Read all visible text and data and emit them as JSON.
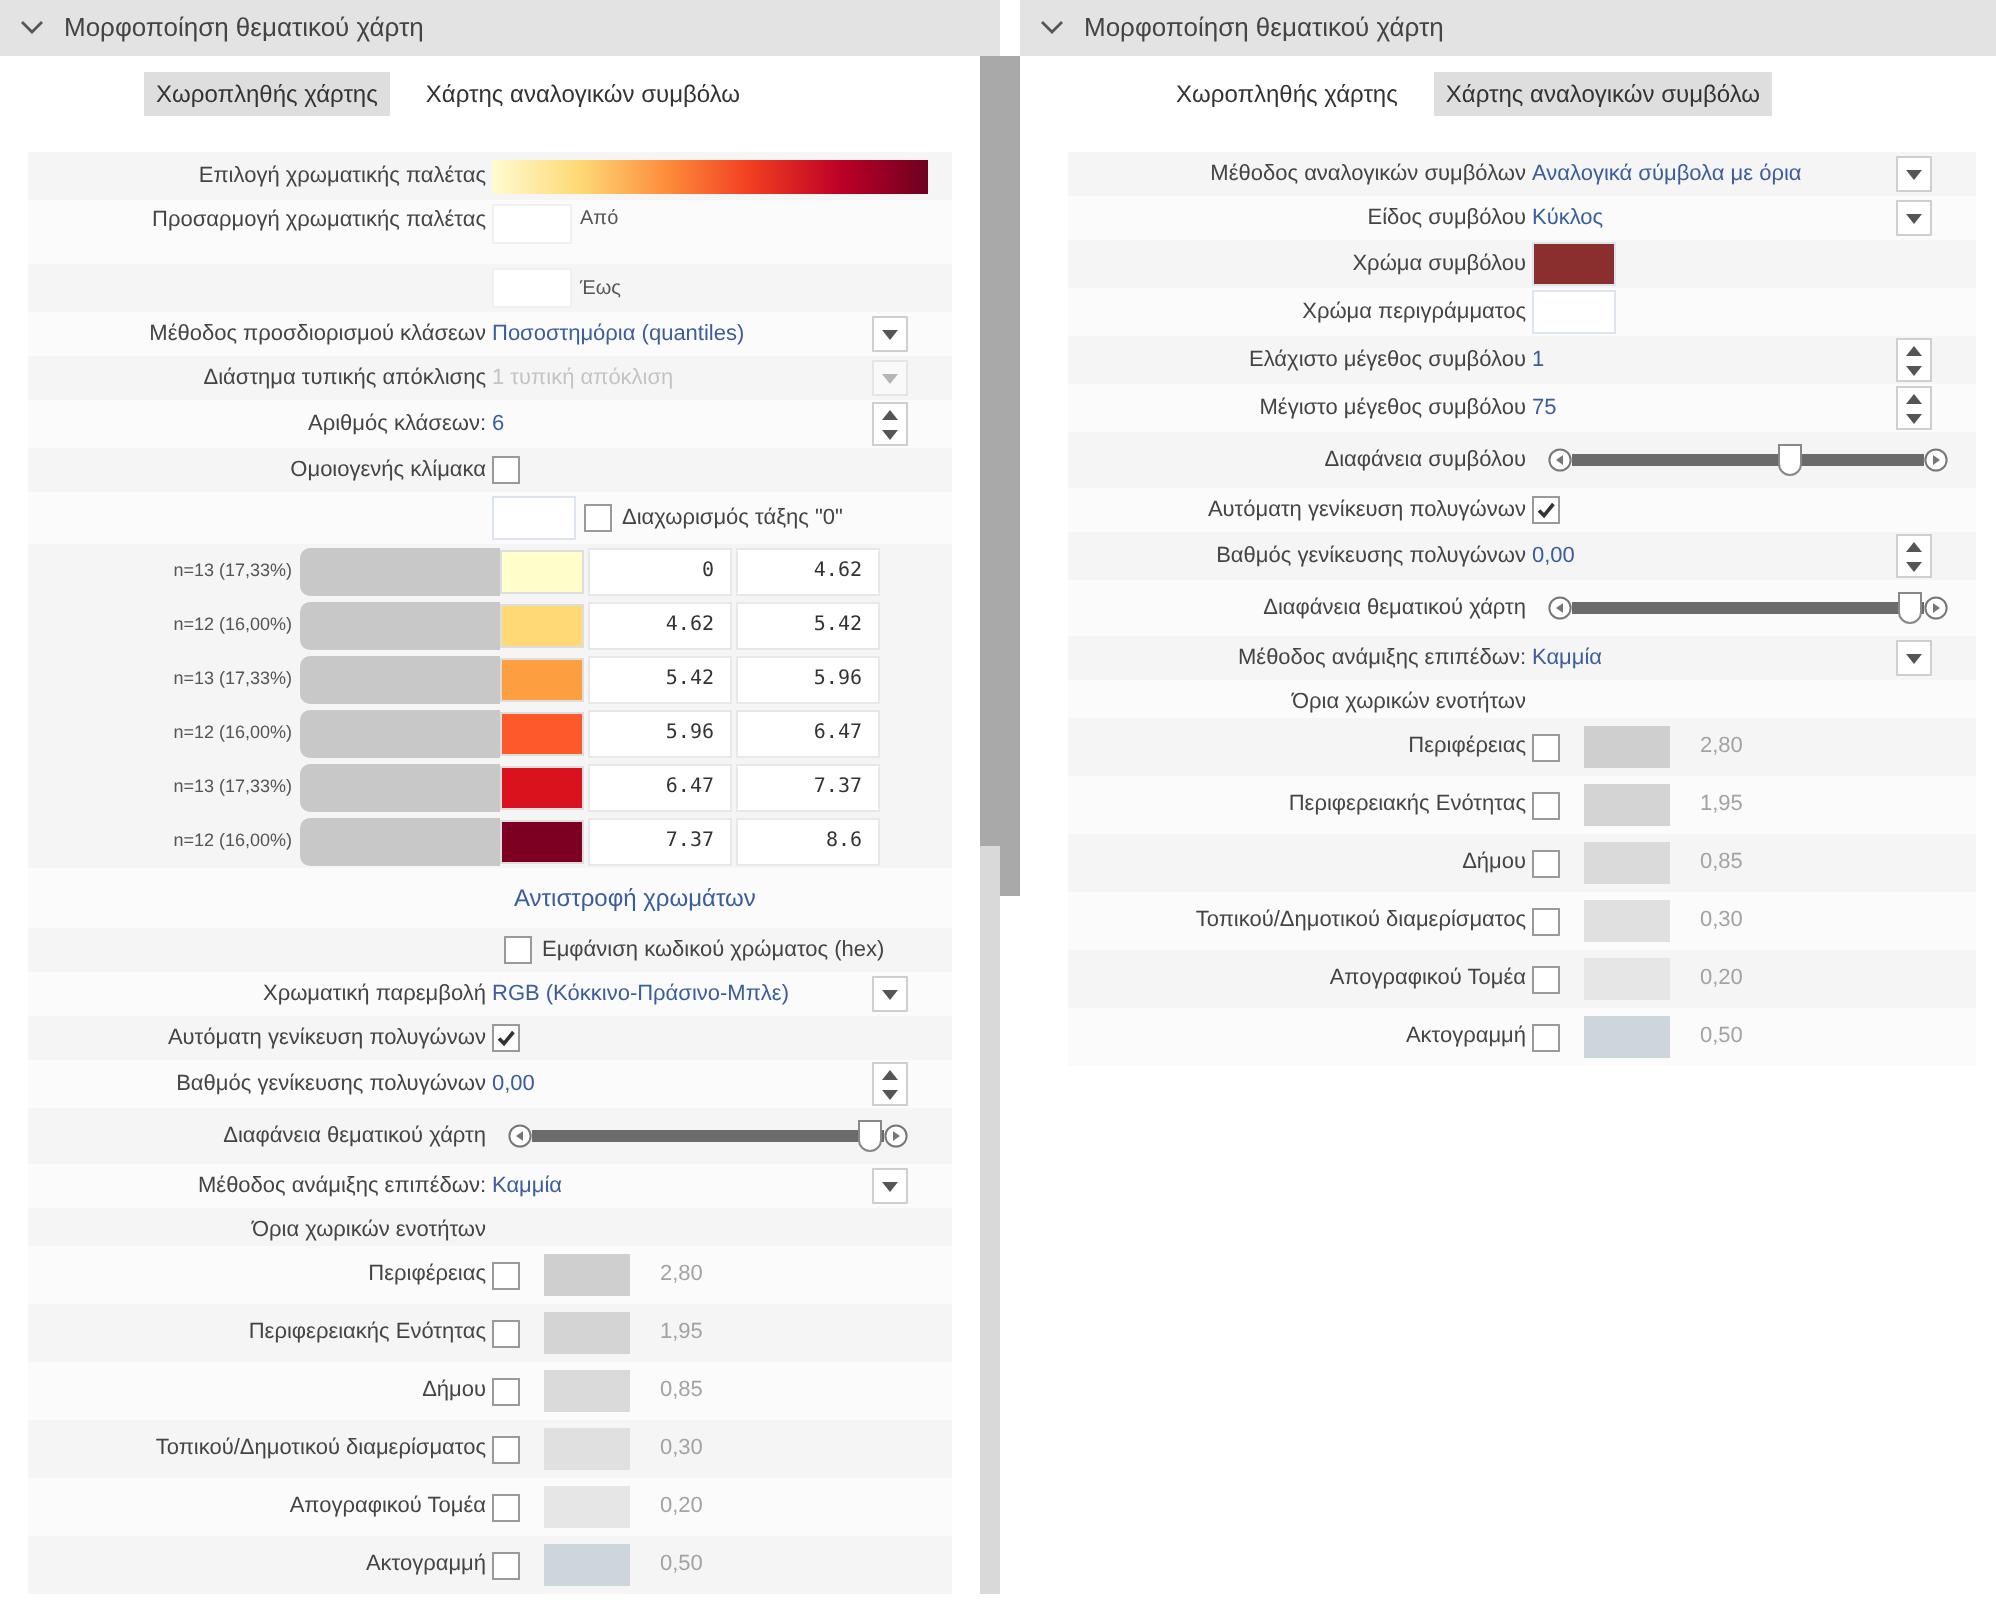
{
  "panels": [
    {
      "title": "Μορφοποίηση θεματικού χάρτη",
      "expanded": true,
      "tabs": [
        {
          "label": "Χωροπληθής χάρτης",
          "selected": true
        },
        {
          "label": "Χάρτης αναλογικών συμβόλω",
          "selected": false
        }
      ],
      "rows": [
        {
          "kind": "palette",
          "label": "Επιλογή χρωματικής παλέτας"
        },
        {
          "kind": "text_input",
          "label": "Προσαρμογή χρωματικής παλέτας",
          "suffix": "Από"
        },
        {
          "kind": "text_input",
          "suffix": "Έως"
        },
        {
          "kind": "dropdown",
          "label": "Μέθοδος προσδιορισμού κλάσεων",
          "value": "Ποσοστημόρια (quantiles)",
          "disabled": false
        },
        {
          "kind": "dropdown",
          "label": "Διάστημα τυπικής απόκλισης",
          "value": "1 τυπική απόκλιση",
          "disabled": true
        },
        {
          "kind": "spinner",
          "label": "Αριθμός κλάσεων:",
          "value": "6"
        },
        {
          "kind": "checkbox",
          "label": "Ομοιογενής κλίμακα",
          "checked": false
        },
        {
          "kind": "zero_split",
          "label": "Διαχωρισμός τάξης \"0\"",
          "checked": false
        },
        {
          "kind": "classes",
          "items": [
            {
              "count": "n=13 (17,33%)",
              "color": "#ffffcc",
              "from": "0",
              "to": "4.62"
            },
            {
              "count": "n=12 (16,00%)",
              "color": "#fed976",
              "from": "4.62",
              "to": "5.42"
            },
            {
              "count": "n=13 (17,33%)",
              "color": "#fd9f40",
              "from": "5.42",
              "to": "5.96"
            },
            {
              "count": "n=12 (16,00%)",
              "color": "#fc5a2a",
              "from": "5.96",
              "to": "6.47"
            },
            {
              "count": "n=13 (17,33%)",
              "color": "#d9121e",
              "from": "6.47",
              "to": "7.37"
            },
            {
              "count": "n=12 (16,00%)",
              "color": "#7d0022",
              "from": "7.37",
              "to": "8.6"
            }
          ]
        },
        {
          "kind": "link",
          "text": "Αντιστροφή χρωμάτων"
        },
        {
          "kind": "check_right",
          "label": "Εμφάνιση κωδικού χρώματος (hex)",
          "checked": false
        },
        {
          "kind": "dropdown",
          "label": "Χρωματική παρεμβολή",
          "value": "RGB (Κόκκινο-Πράσινο-Μπλε)",
          "disabled": false
        },
        {
          "kind": "checkbox",
          "label": "Αυτόματη γενίκευση πολυγώνων",
          "checked": true
        },
        {
          "kind": "spinner",
          "label": "Βαθμός γενίκευσης πολυγώνων",
          "value": "0,00"
        },
        {
          "kind": "slider",
          "label": "Διαφάνεια θεματικού χάρτη",
          "level": 0.96
        },
        {
          "kind": "dropdown",
          "label": "Μέθοδος ανάμιξης επιπέδων:",
          "value": "Καμμία",
          "disabled": false
        },
        {
          "kind": "heading",
          "label": "Όρια χωρικών ενοτήτων"
        },
        {
          "kind": "boundary",
          "label": "Περιφέρειας",
          "checked": false,
          "color": "#cfcfcf",
          "value": "2,80"
        },
        {
          "kind": "boundary",
          "label": "Περιφερειακής Ενότητας",
          "checked": false,
          "color": "#d4d4d4",
          "value": "1,95"
        },
        {
          "kind": "boundary",
          "label": "Δήμου",
          "checked": false,
          "color": "#dadada",
          "value": "0,85"
        },
        {
          "kind": "boundary",
          "label": "Τοπικού/Δημοτικού διαμερίσματος",
          "checked": false,
          "color": "#e0e0e0",
          "value": "0,30"
        },
        {
          "kind": "boundary",
          "label": "Απογραφικού Τομέα",
          "checked": false,
          "color": "#e6e6e6",
          "value": "0,20"
        },
        {
          "kind": "boundary",
          "label": "Ακτογραμμή",
          "checked": false,
          "color": "#cdd6db",
          "value": "0,50"
        }
      ]
    },
    {
      "title": "Μορφοποίηση θεματικού χάρτη",
      "expanded": true,
      "tabs": [
        {
          "label": "Χωροπληθής χάρτης",
          "selected": false
        },
        {
          "label": "Χάρτης αναλογικών συμβόλω",
          "selected": true
        }
      ],
      "rows": [
        {
          "kind": "dropdown",
          "label": "Μέθοδος αναλογικών συμβόλων",
          "value": "Αναλογικά σύμβολα με όρια",
          "disabled": false
        },
        {
          "kind": "dropdown",
          "label": "Είδος συμβόλου",
          "value": "Κύκλος",
          "disabled": false
        },
        {
          "kind": "color",
          "label": "Χρώμα συμβόλου",
          "color": "#8b2e2e"
        },
        {
          "kind": "color",
          "label": "Χρώμα περιγράμματος",
          "color": "#ffffff"
        },
        {
          "kind": "spinner",
          "label": "Ελάχιστο μέγεθος συμβόλου",
          "value": "1"
        },
        {
          "kind": "spinner",
          "label": "Μέγιστο μέγεθος συμβόλου",
          "value": "75"
        },
        {
          "kind": "slider",
          "label": "Διαφάνεια συμβόλου",
          "level": 0.62
        },
        {
          "kind": "checkbox",
          "label": "Αυτόματη γενίκευση πολυγώνων",
          "checked": true
        },
        {
          "kind": "spinner",
          "label": "Βαθμός γενίκευσης πολυγώνων",
          "value": "0,00"
        },
        {
          "kind": "slider",
          "label": "Διαφάνεια θεματικού χάρτη",
          "level": 0.96
        },
        {
          "kind": "dropdown",
          "label": "Μέθοδος ανάμιξης επιπέδων:",
          "value": "Καμμία",
          "disabled": false
        },
        {
          "kind": "heading",
          "label": "Όρια χωρικών ενοτήτων"
        },
        {
          "kind": "boundary",
          "label": "Περιφέρειας",
          "checked": false,
          "color": "#cfcfcf",
          "value": "2,80"
        },
        {
          "kind": "boundary",
          "label": "Περιφερειακής Ενότητας",
          "checked": false,
          "color": "#d4d4d4",
          "value": "1,95"
        },
        {
          "kind": "boundary",
          "label": "Δήμου",
          "checked": false,
          "color": "#dadada",
          "value": "0,85"
        },
        {
          "kind": "boundary",
          "label": "Τοπικού/Δημοτικού διαμερίσματος",
          "checked": false,
          "color": "#e0e0e0",
          "value": "0,30"
        },
        {
          "kind": "boundary",
          "label": "Απογραφικού Τομέα",
          "checked": false,
          "color": "#e6e6e6",
          "value": "0,20"
        },
        {
          "kind": "boundary",
          "label": "Ακτογραμμή",
          "checked": false,
          "color": "#cdd6db",
          "value": "0,50"
        }
      ]
    }
  ]
}
